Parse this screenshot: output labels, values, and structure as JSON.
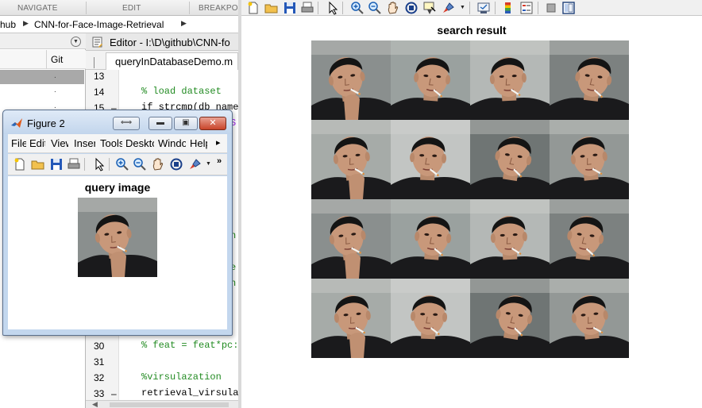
{
  "ribbon": {
    "sections": [
      "NAVIGATE",
      "EDIT",
      "BREAKPOI"
    ]
  },
  "path_bar": {
    "segments": [
      "hub",
      "CNN-for-Face-Image-Retrieval"
    ]
  },
  "file_browser": {
    "collapse_icon": "chevron-down-circle-icon",
    "column_git": "Git",
    "git_status": ".",
    "colors": {
      "selected_row": "#a9a9a9"
    }
  },
  "editor": {
    "title": "Editor - I:\\D\\github\\CNN-fo",
    "tab_label": "queryInDatabaseDemo.m",
    "lines": [
      {
        "num": "13",
        "dash": "",
        "text": "",
        "kind": "code"
      },
      {
        "num": "14",
        "dash": "",
        "text": "% load dataset",
        "kind": "comment"
      },
      {
        "num": "15",
        "dash": "–",
        "text": "if strcmp(db_name",
        "kind": "code"
      },
      {
        "num": "30",
        "dash": "",
        "text": "% feat = feat*pc:",
        "kind": "comment"
      },
      {
        "num": "31",
        "dash": "",
        "text": "",
        "kind": "code"
      },
      {
        "num": "32",
        "dash": "",
        "text": "%virsulazation",
        "kind": "comment"
      },
      {
        "num": "33",
        "dash": "–",
        "text": "retrieval_virsula",
        "kind": "code"
      }
    ]
  },
  "figure2": {
    "title": "Figure 2",
    "menus": [
      "File",
      "Edit",
      "View",
      "Insert",
      "Tools",
      "Desktop",
      "Window",
      "Help"
    ],
    "menu_arrow": "▸",
    "toolbar_overflow": "»",
    "axes_title": "query image",
    "controls": [
      "restore-dock-icon",
      "minimize-icon",
      "maximize-icon",
      "close-icon"
    ]
  },
  "result_figure": {
    "title": "search result",
    "toolbar_icons": [
      "new-figure-icon",
      "open-icon",
      "save-icon",
      "print-icon",
      "pointer-icon",
      "zoom-in-icon",
      "zoom-out-icon",
      "pan-icon",
      "rotate-icon",
      "data-cursor-icon",
      "brush-icon",
      "link-icon",
      "colorbar-icon",
      "legend-icon",
      "hide-plot-tools-icon",
      "show-plot-tools-icon"
    ],
    "grid": {
      "rows": 4,
      "cols": 4,
      "count": 16
    }
  },
  "colors": {
    "comment": "#228b22",
    "window_frame": "#c3d7ee",
    "close_button": "#c8442a"
  }
}
